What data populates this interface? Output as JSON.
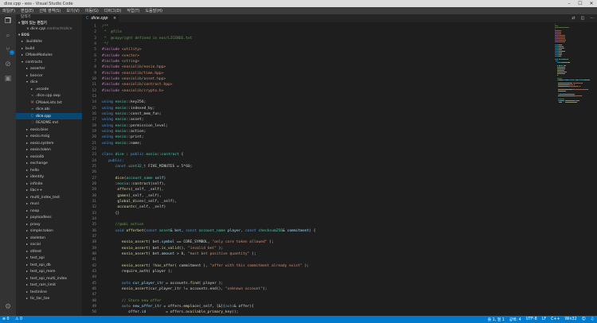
{
  "window": {
    "title": "dice.cpp - eos - Visual Studio Code"
  },
  "menu": [
    "파일(F)",
    "편집(E)",
    "선택 영역(S)",
    "보기(V)",
    "이동(G)",
    "디버그(D)",
    "작업(T)",
    "도움말(H)"
  ],
  "sidebar": {
    "title": "탐색기",
    "open_editors_label": "열려 있는 편집기",
    "open_file": "dice.cpp",
    "open_file_path": "contracts\\dice",
    "project_label": "EOS",
    "tree": [
      {
        "label": ".buildkite",
        "depth": 1,
        "type": "folder",
        "open": false
      },
      {
        "label": "build",
        "depth": 1,
        "type": "folder",
        "open": false
      },
      {
        "label": "CMakeModules",
        "depth": 1,
        "type": "folder",
        "open": false
      },
      {
        "label": "contracts",
        "depth": 1,
        "type": "folder",
        "open": true
      },
      {
        "label": "asserter",
        "depth": 2,
        "type": "folder",
        "open": false
      },
      {
        "label": "bancor",
        "depth": 2,
        "type": "folder",
        "open": false
      },
      {
        "label": "dice",
        "depth": 2,
        "type": "folder",
        "open": true
      },
      {
        "label": ".vscode",
        "depth": 3,
        "type": "folder",
        "open": false
      },
      {
        "label": ".dice.cpp.swp",
        "depth": 3,
        "type": "file",
        "icon": "≡"
      },
      {
        "label": "CMakeLists.txt",
        "depth": 3,
        "type": "file",
        "icon": "M"
      },
      {
        "label": "dice.abi",
        "depth": 3,
        "type": "file",
        "icon": "≡"
      },
      {
        "label": "dice.cpp",
        "depth": 3,
        "type": "file",
        "icon": "C",
        "selected": true
      },
      {
        "label": "README.md",
        "depth": 3,
        "type": "file",
        "icon": "ⓘ"
      },
      {
        "label": "eosio.bios",
        "depth": 2,
        "type": "folder",
        "open": false
      },
      {
        "label": "eosio.msig",
        "depth": 2,
        "type": "folder",
        "open": false
      },
      {
        "label": "eosio.system",
        "depth": 2,
        "type": "folder",
        "open": false
      },
      {
        "label": "eosio.token",
        "depth": 2,
        "type": "folder",
        "open": false
      },
      {
        "label": "eosiolib",
        "depth": 2,
        "type": "folder",
        "open": false
      },
      {
        "label": "exchange",
        "depth": 2,
        "type": "folder",
        "open": false
      },
      {
        "label": "hello",
        "depth": 2,
        "type": "folder",
        "open": false
      },
      {
        "label": "identity",
        "depth": 2,
        "type": "folder",
        "open": false
      },
      {
        "label": "infinite",
        "depth": 2,
        "type": "folder",
        "open": false
      },
      {
        "label": "libc++",
        "depth": 2,
        "type": "folder",
        "open": false
      },
      {
        "label": "multi_index_test",
        "depth": 2,
        "type": "folder",
        "open": false
      },
      {
        "label": "musl",
        "depth": 2,
        "type": "folder",
        "open": false
      },
      {
        "label": "noop",
        "depth": 2,
        "type": "folder",
        "open": false
      },
      {
        "label": "payloadless",
        "depth": 2,
        "type": "folder",
        "open": false
      },
      {
        "label": "proxy",
        "depth": 2,
        "type": "folder",
        "open": false
      },
      {
        "label": "simple.token",
        "depth": 2,
        "type": "folder",
        "open": false
      },
      {
        "label": "skeleton",
        "depth": 2,
        "type": "folder",
        "open": false
      },
      {
        "label": "social",
        "depth": 2,
        "type": "folder",
        "open": false
      },
      {
        "label": "stltest",
        "depth": 2,
        "type": "folder",
        "open": false
      },
      {
        "label": "test_api",
        "depth": 2,
        "type": "folder",
        "open": false
      },
      {
        "label": "test_api_db",
        "depth": 2,
        "type": "folder",
        "open": false
      },
      {
        "label": "test_api_mem",
        "depth": 2,
        "type": "folder",
        "open": false
      },
      {
        "label": "test_api_multi_index",
        "depth": 2,
        "type": "folder",
        "open": false
      },
      {
        "label": "test_ram_limit",
        "depth": 2,
        "type": "folder",
        "open": false
      },
      {
        "label": "testinline",
        "depth": 2,
        "type": "folder",
        "open": false
      },
      {
        "label": "tic_tac_toe",
        "depth": 2,
        "type": "folder",
        "open": false
      }
    ]
  },
  "tab": {
    "label": "dice.cpp"
  },
  "editor": {
    "lines": [
      [
        [
          "c-cm",
          "/**"
        ]
      ],
      [
        [
          "c-cm",
          " *  @file"
        ]
      ],
      [
        [
          "c-cm",
          " *  @copyright defined in eos/LICENSE.txt"
        ]
      ],
      [
        [
          "c-cm",
          " */"
        ]
      ],
      [
        [
          "c-pp",
          "#include "
        ],
        [
          "c-st",
          "<utility>"
        ]
      ],
      [
        [
          "c-pp",
          "#include "
        ],
        [
          "c-st",
          "<vector>"
        ]
      ],
      [
        [
          "c-pp",
          "#include "
        ],
        [
          "c-st",
          "<string>"
        ]
      ],
      [
        [
          "c-pp",
          "#include "
        ],
        [
          "c-st",
          "<eosiolib/eosio.hpp>"
        ]
      ],
      [
        [
          "c-pp",
          "#include "
        ],
        [
          "c-st",
          "<eosiolib/time.hpp>"
        ]
      ],
      [
        [
          "c-pp",
          "#include "
        ],
        [
          "c-st",
          "<eosiolib/asset.hpp>"
        ]
      ],
      [
        [
          "c-pp",
          "#include "
        ],
        [
          "c-st",
          "<eosiolib/contract.hpp>"
        ]
      ],
      [
        [
          "c-pp",
          "#include "
        ],
        [
          "c-st",
          "<eosiolib/crypto.h>"
        ]
      ],
      [],
      [
        [
          "c-kw",
          "using "
        ],
        [
          "c-tp",
          "eosio"
        ],
        [
          "c-tx",
          "::key256;"
        ]
      ],
      [
        [
          "c-kw",
          "using "
        ],
        [
          "c-tp",
          "eosio"
        ],
        [
          "c-tx",
          "::indexed_by;"
        ]
      ],
      [
        [
          "c-kw",
          "using "
        ],
        [
          "c-tp",
          "eosio"
        ],
        [
          "c-tx",
          "::const_mem_fun;"
        ]
      ],
      [
        [
          "c-kw",
          "using "
        ],
        [
          "c-tp",
          "eosio"
        ],
        [
          "c-tx",
          "::asset;"
        ]
      ],
      [
        [
          "c-kw",
          "using "
        ],
        [
          "c-tp",
          "eosio"
        ],
        [
          "c-tx",
          "::permission_level;"
        ]
      ],
      [
        [
          "c-kw",
          "using "
        ],
        [
          "c-tp",
          "eosio"
        ],
        [
          "c-tx",
          "::action;"
        ]
      ],
      [
        [
          "c-kw",
          "using "
        ],
        [
          "c-tp",
          "eosio"
        ],
        [
          "c-tx",
          "::print;"
        ]
      ],
      [
        [
          "c-kw",
          "using "
        ],
        [
          "c-tp",
          "eosio"
        ],
        [
          "c-tx",
          "::name;"
        ]
      ],
      [],
      [
        [
          "c-kw",
          "class "
        ],
        [
          "c-tp",
          "dice"
        ],
        [
          "c-tx",
          " : "
        ],
        [
          "c-kw",
          "public "
        ],
        [
          "c-tp",
          "eosio"
        ],
        [
          "c-tx",
          "::"
        ],
        [
          "c-tp",
          "contract"
        ],
        [
          "c-tx",
          " {"
        ]
      ],
      [
        [
          "c-kw",
          "   public:"
        ]
      ],
      [
        [
          "c-tx",
          "      "
        ],
        [
          "c-kw",
          "const "
        ],
        [
          "c-tp",
          "uint32_t"
        ],
        [
          "c-tx",
          " FIVE_MINUTES = "
        ],
        [
          "c-nm",
          "5"
        ],
        [
          "c-tx",
          "*"
        ],
        [
          "c-nm",
          "60"
        ],
        [
          "c-tx",
          ";"
        ]
      ],
      [],
      [
        [
          "c-tx",
          "      "
        ],
        [
          "c-fn",
          "dice"
        ],
        [
          "c-tx",
          "("
        ],
        [
          "c-tp",
          "account_name"
        ],
        [
          "c-tx",
          " "
        ],
        [
          "c-vr",
          "self"
        ],
        [
          "c-tx",
          ")"
        ]
      ],
      [
        [
          "c-tx",
          "      :"
        ],
        [
          "c-tp",
          "eosio"
        ],
        [
          "c-tx",
          "::"
        ],
        [
          "c-fn",
          "contract"
        ],
        [
          "c-tx",
          "(self),"
        ]
      ],
      [
        [
          "c-tx",
          "       "
        ],
        [
          "c-fn",
          "offers"
        ],
        [
          "c-tx",
          "(_self, _self),"
        ]
      ],
      [
        [
          "c-tx",
          "       "
        ],
        [
          "c-fn",
          "games"
        ],
        [
          "c-tx",
          "(_self, _self),"
        ]
      ],
      [
        [
          "c-tx",
          "       "
        ],
        [
          "c-fn",
          "global_dices"
        ],
        [
          "c-tx",
          "(_self, _self),"
        ]
      ],
      [
        [
          "c-tx",
          "       "
        ],
        [
          "c-fn",
          "accounts"
        ],
        [
          "c-tx",
          "(_self, _self)"
        ]
      ],
      [
        [
          "c-tx",
          "      {}"
        ]
      ],
      [],
      [
        [
          "c-cm",
          "      //@abi action"
        ]
      ],
      [
        [
          "c-tx",
          "      "
        ],
        [
          "c-kw",
          "void "
        ],
        [
          "c-fn",
          "offerbet"
        ],
        [
          "c-tx",
          "("
        ],
        [
          "c-kw",
          "const "
        ],
        [
          "c-tp",
          "asset"
        ],
        [
          "c-tx",
          "& "
        ],
        [
          "c-vr",
          "bet"
        ],
        [
          "c-tx",
          ", "
        ],
        [
          "c-kw",
          "const "
        ],
        [
          "c-tp",
          "account_name"
        ],
        [
          "c-tx",
          " "
        ],
        [
          "c-vr",
          "player"
        ],
        [
          "c-tx",
          ", "
        ],
        [
          "c-kw",
          "const "
        ],
        [
          "c-tp",
          "checksum256"
        ],
        [
          "c-tx",
          "& "
        ],
        [
          "c-vr",
          "commitment"
        ],
        [
          "c-tx",
          ") {"
        ]
      ],
      [],
      [
        [
          "c-tx",
          "         "
        ],
        [
          "c-fn",
          "eosio_assert"
        ],
        [
          "c-tx",
          "( bet."
        ],
        [
          "c-vr",
          "symbol"
        ],
        [
          "c-tx",
          " == CORE_SYMBOL, "
        ],
        [
          "c-st",
          "\"only core token allowed\""
        ],
        [
          "c-tx",
          " );"
        ]
      ],
      [
        [
          "c-tx",
          "         "
        ],
        [
          "c-fn",
          "eosio_assert"
        ],
        [
          "c-tx",
          "( bet."
        ],
        [
          "c-fn",
          "is_valid"
        ],
        [
          "c-tx",
          "(), "
        ],
        [
          "c-st",
          "\"invalid bet\""
        ],
        [
          "c-tx",
          " );"
        ]
      ],
      [
        [
          "c-tx",
          "         "
        ],
        [
          "c-fn",
          "eosio_assert"
        ],
        [
          "c-tx",
          "( bet."
        ],
        [
          "c-vr",
          "amount"
        ],
        [
          "c-tx",
          " > "
        ],
        [
          "c-nm",
          "0"
        ],
        [
          "c-tx",
          ", "
        ],
        [
          "c-st",
          "\"must bet positive quantity\""
        ],
        [
          "c-tx",
          " );"
        ]
      ],
      [],
      [
        [
          "c-tx",
          "         "
        ],
        [
          "c-fn",
          "eosio_assert"
        ],
        [
          "c-tx",
          "( !"
        ],
        [
          "c-fn",
          "has_offer"
        ],
        [
          "c-tx",
          "( commitment ), "
        ],
        [
          "c-st",
          "\"offer with this commitment already exist\""
        ],
        [
          "c-tx",
          " );"
        ]
      ],
      [
        [
          "c-tx",
          "         "
        ],
        [
          "c-fn",
          "require_auth"
        ],
        [
          "c-tx",
          "( player );"
        ]
      ],
      [],
      [
        [
          "c-tx",
          "         "
        ],
        [
          "c-kw",
          "auto "
        ],
        [
          "c-vr",
          "cur_player_itr"
        ],
        [
          "c-tx",
          " = accounts."
        ],
        [
          "c-fn",
          "find"
        ],
        [
          "c-tx",
          "( player );"
        ]
      ],
      [
        [
          "c-tx",
          "         "
        ],
        [
          "c-fn",
          "eosio_assert"
        ],
        [
          "c-tx",
          "(cur_player_itr != accounts."
        ],
        [
          "c-fn",
          "end"
        ],
        [
          "c-tx",
          "(), "
        ],
        [
          "c-st",
          "\"unknown account\""
        ],
        [
          "c-tx",
          ");"
        ]
      ],
      [],
      [
        [
          "c-cm",
          "         // Store new offer"
        ]
      ],
      [
        [
          "c-tx",
          "         "
        ],
        [
          "c-kw",
          "auto "
        ],
        [
          "c-vr",
          "new_offer_itr"
        ],
        [
          "c-tx",
          " = offers."
        ],
        [
          "c-fn",
          "emplace"
        ],
        [
          "c-tx",
          "(_self, [&]("
        ],
        [
          "c-kw",
          "auto"
        ],
        [
          "c-tx",
          "& offer){"
        ]
      ],
      [
        [
          "c-tx",
          "            offer."
        ],
        [
          "c-vr",
          "id"
        ],
        [
          "c-tx",
          "         = offers."
        ],
        [
          "c-fn",
          "available_primary_key"
        ],
        [
          "c-tx",
          "();"
        ]
      ]
    ]
  },
  "status": {
    "errors": "0",
    "warnings": "0",
    "cursor": "줄 1, 열 1",
    "spaces": "공백: 4",
    "encoding": "UTF-8",
    "eol": "LF",
    "language": "C++",
    "platform": "Win32"
  },
  "colors": {
    "accent": "#007acc",
    "selection": "#094771"
  }
}
